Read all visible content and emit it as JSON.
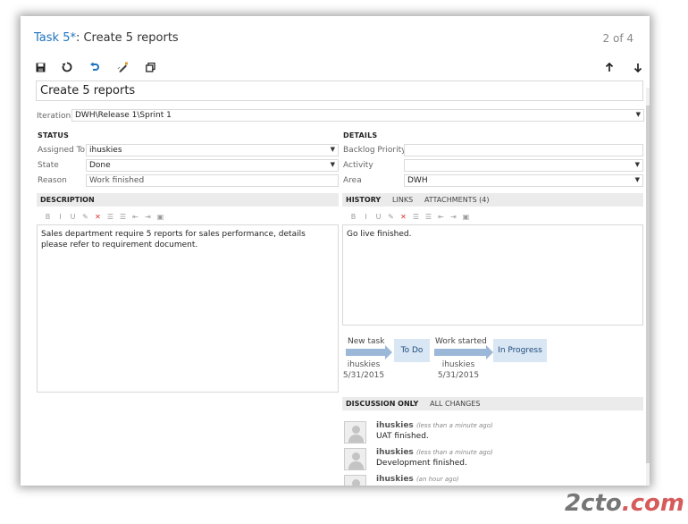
{
  "header": {
    "task_id": "Task 5*",
    "task_title": ": Create 5 reports",
    "counter": "2 of 4"
  },
  "toolbar": {
    "save_icon": "save-icon",
    "refresh_icon": "refresh-icon",
    "undo_icon": "undo-icon",
    "edit_icon": "edit-icon",
    "copy_icon": "copy-icon",
    "up_icon": "arrow-up-icon",
    "down_icon": "arrow-down-icon"
  },
  "form": {
    "title_value": "Create 5 reports",
    "iteration_label": "Iteration",
    "iteration_value": "DWH\\Release 1\\Sprint 1",
    "status_section": "STATUS",
    "details_section": "DETAILS",
    "assigned_label": "Assigned To",
    "assigned_value": "ihuskies",
    "state_label": "State",
    "state_value": "Done",
    "reason_label": "Reason",
    "reason_value": "Work finished",
    "backlog_label": "Backlog Priority",
    "backlog_value": "",
    "activity_label": "Activity",
    "activity_value": "",
    "area_label": "Area",
    "area_value": "DWH"
  },
  "description": {
    "header": "DESCRIPTION",
    "text": "Sales department require 5 reports for sales performance, details please refer to requirement document."
  },
  "history": {
    "tabs": [
      "HISTORY",
      "LINKS",
      "ATTACHMENTS (4)"
    ],
    "text": "Go live finished.",
    "flow": [
      {
        "label": "New task",
        "state": "To Do",
        "user": "ihuskies",
        "date": "5/31/2015"
      },
      {
        "label": "Work started",
        "state": "In Progress",
        "user": "ihuskies",
        "date": "5/31/2015"
      }
    ]
  },
  "discussion": {
    "tabs": [
      "DISCUSSION ONLY",
      "ALL CHANGES"
    ],
    "items": [
      {
        "user": "ihuskies",
        "time": "(less than a minute ago)",
        "text": "UAT finished."
      },
      {
        "user": "ihuskies",
        "time": "(less than a minute ago)",
        "text": "Development finished."
      },
      {
        "user": "ihuskies",
        "time": "(an hour ago)",
        "text": ""
      }
    ]
  },
  "formatting": [
    "B",
    "I",
    "U",
    "✎",
    "✕",
    "☰",
    "☰",
    "⇤",
    "⇥",
    "▣"
  ],
  "watermark": {
    "main": "2cto",
    "suffix": ".com"
  }
}
